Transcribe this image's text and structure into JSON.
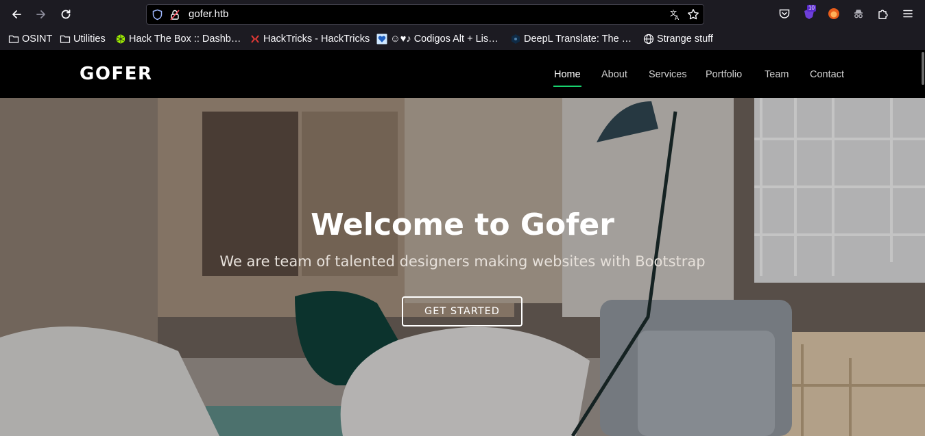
{
  "browser": {
    "url": "gofer.htb",
    "extension_badge": "10",
    "bookmarks": [
      {
        "label": "OSINT",
        "icon": "folder-icon"
      },
      {
        "label": "Utilities",
        "icon": "folder-icon"
      },
      {
        "label": "Hack The Box :: Dashb…",
        "icon": "hackthebox-icon"
      },
      {
        "label": "HackTricks - HackTricks",
        "icon": "hacktricks-icon"
      },
      {
        "label": "☺♥♪ Codigos Alt + Lis…",
        "icon": "heart-icon"
      },
      {
        "label": "DeepL Translate: The …",
        "icon": "deepl-icon"
      },
      {
        "label": "Strange stuff",
        "icon": "globe-icon"
      }
    ]
  },
  "site": {
    "logo": "GOFER",
    "nav": [
      "Home",
      "About",
      "Services",
      "Portfolio",
      "Team",
      "Contact"
    ],
    "active_nav": "Home",
    "accent_color": "#18d26e",
    "hero": {
      "title": "Welcome to Gofer",
      "subtitle": "We are team of talented designers making websites with Bootstrap",
      "cta": "GET STARTED"
    }
  }
}
